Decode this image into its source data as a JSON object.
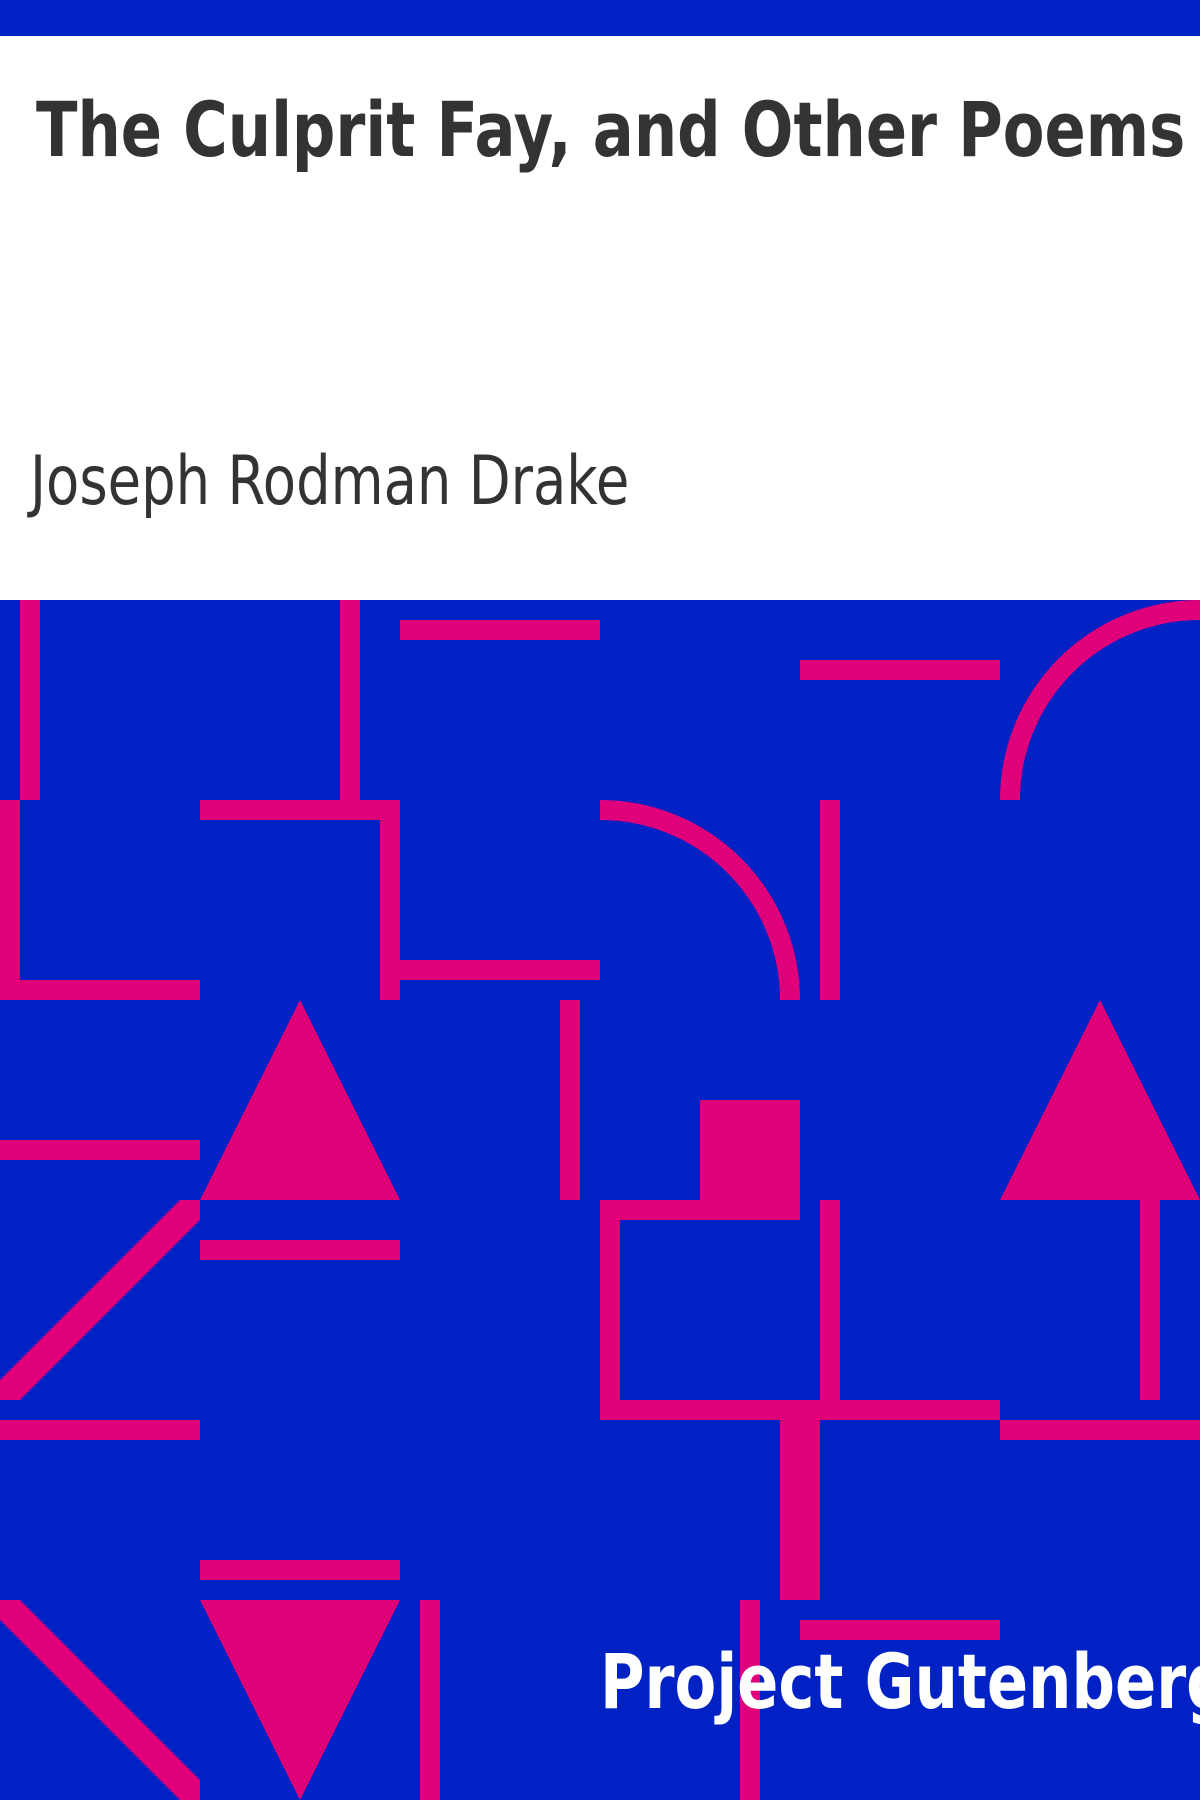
{
  "cover": {
    "title": "The Culprit Fay, and Other Poems",
    "author": "Joseph Rodman Drake",
    "publisher": "Project Gutenberg"
  },
  "colors": {
    "background": "#0022c5",
    "accent": "#e0007a",
    "title_text": "#333333",
    "publisher_text": "#ffffff",
    "page": "#ffffff"
  },
  "artwork": "geometric-pattern-lines-arcs-triangles"
}
